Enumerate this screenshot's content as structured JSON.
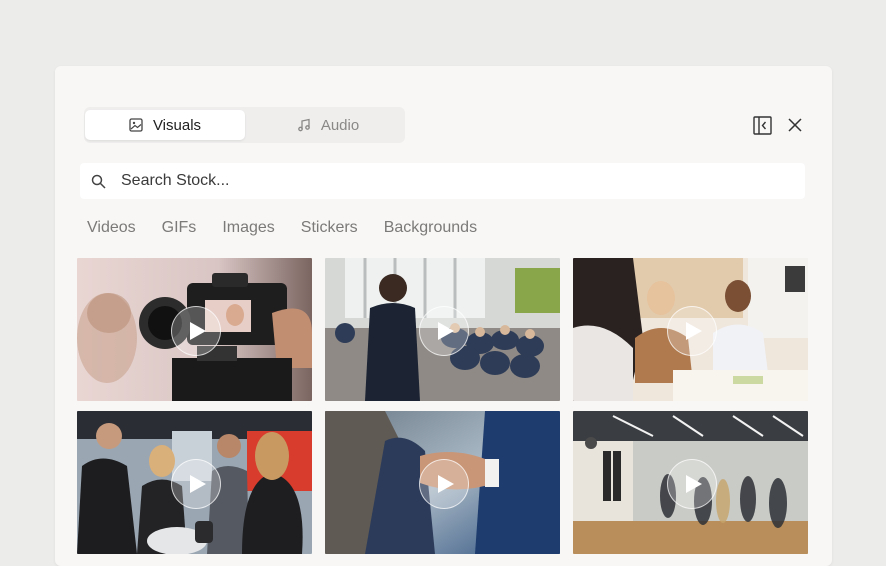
{
  "toggle": {
    "visuals_label": "Visuals",
    "audio_label": "Audio",
    "visuals_icon": "image-icon",
    "audio_icon": "music-note-icon"
  },
  "header": {
    "collapse_icon": "collapse-panel-icon",
    "close_icon": "close-icon"
  },
  "search": {
    "placeholder": "Search Stock...",
    "icon": "search-icon"
  },
  "tabs": [
    {
      "label": "Videos"
    },
    {
      "label": "GIFs"
    },
    {
      "label": "Images"
    },
    {
      "label": "Stickers"
    },
    {
      "label": "Backgrounds"
    }
  ],
  "results": [
    {
      "kind": "video",
      "subject": "camera filming woman",
      "has_play": true
    },
    {
      "kind": "video",
      "subject": "speaker addressing conference audience",
      "has_play": true
    },
    {
      "kind": "video",
      "subject": "colleagues talking in office",
      "has_play": true
    },
    {
      "kind": "video",
      "subject": "people at tech expo booth",
      "has_play": true
    },
    {
      "kind": "video",
      "subject": "business handshake",
      "has_play": true
    },
    {
      "kind": "video",
      "subject": "people walking in office corridor",
      "has_play": true
    }
  ]
}
